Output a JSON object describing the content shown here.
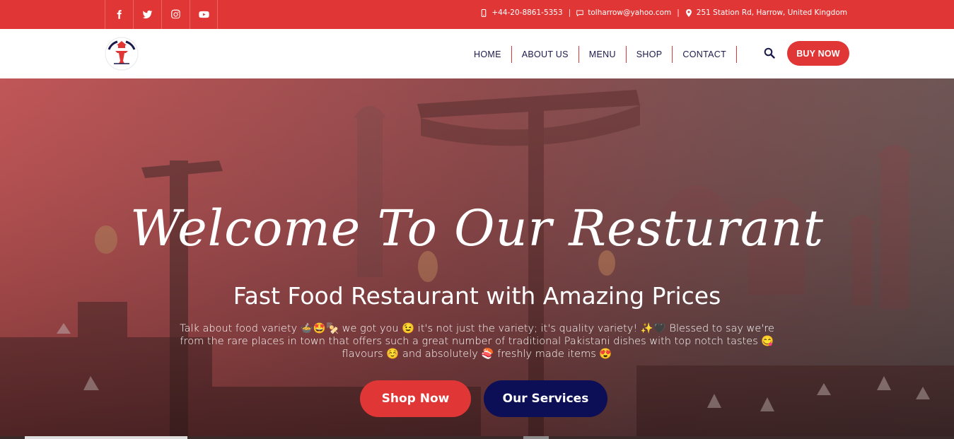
{
  "topbar": {
    "social": [
      "facebook-icon",
      "twitter-icon",
      "instagram-icon",
      "youtube-icon"
    ],
    "phone": "+44-20-8861-5353",
    "email": "tolharrow@yahoo.com",
    "address": "251 Station Rd, Harrow, United Kingdom"
  },
  "header": {
    "logo_alt": "Taste of Lahore",
    "nav": [
      "HOME",
      "ABOUT US",
      "MENU",
      "SHOP",
      "CONTACT"
    ],
    "buy_label": "BUY NOW"
  },
  "hero": {
    "title": "Welcome To Our Resturant",
    "subtitle": "Fast Food Restaurant with Amazing Prices",
    "text": "Talk about food variety 🍲🤩🍢 we got you 😉 it's not just the variety; it's quality variety! ✨🖤 Blessed to say we're from the rare places in town that offers such a great number of traditional Pakistani dishes with top notch tastes 😋 flavours ☺️ and absolutely 🍣 freshly made items 😍",
    "buttons": {
      "shop": "Shop Now",
      "services": "Our Services"
    }
  },
  "colors": {
    "brand_red": "#e03636",
    "navy": "#0c0f55",
    "nav_text": "#1a1a4a"
  }
}
